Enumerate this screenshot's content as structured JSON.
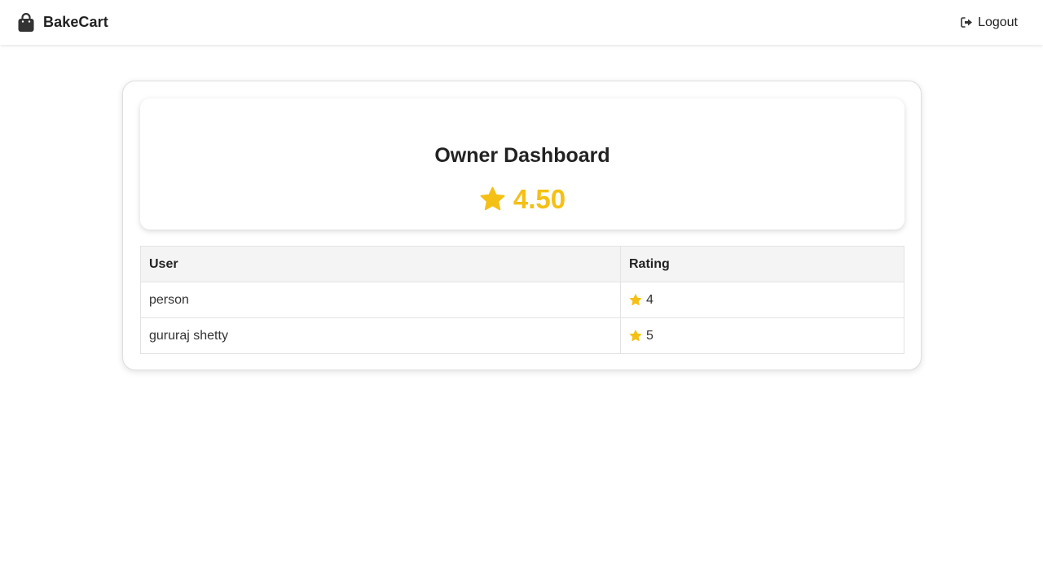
{
  "app": {
    "brand": "BakeCart"
  },
  "nav": {
    "logout_label": "Logout"
  },
  "dashboard": {
    "title": "Owner Dashboard",
    "average_rating": "4.50",
    "accent_color": "#f5c016"
  },
  "table": {
    "headers": [
      "User",
      "Rating"
    ],
    "rows": [
      {
        "user": "person",
        "rating": "4"
      },
      {
        "user": "gururaj shetty",
        "rating": "5"
      }
    ]
  },
  "icons": {
    "brand": "shopping-bag-icon",
    "logout": "sign-out-icon",
    "rating": "star-icon"
  }
}
